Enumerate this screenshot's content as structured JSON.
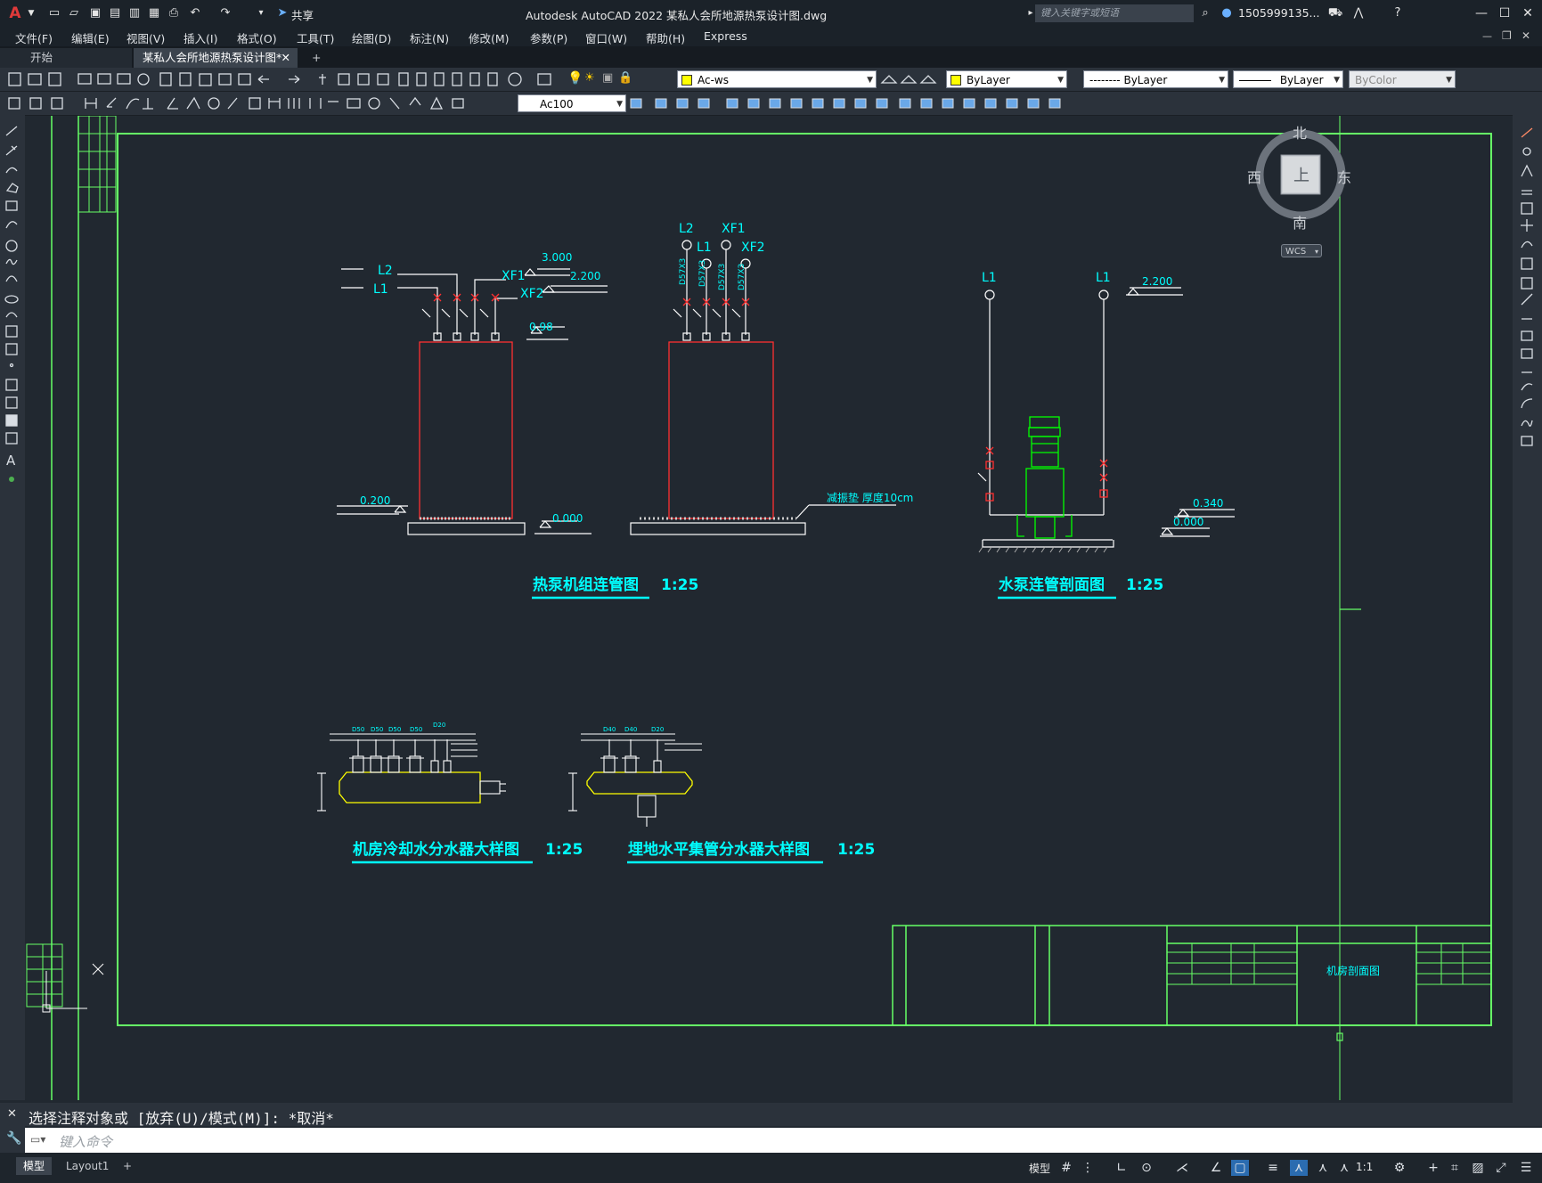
{
  "titlebar": {
    "app_icon": "autocad-a-icon",
    "app_title": "Autodesk AutoCAD 2022    某私人会所地源热泵设计图.dwg",
    "share_label": "共享",
    "search_placeholder": "键入关键字或短语",
    "user_name": "1505999135...",
    "help_icon": "help-icon"
  },
  "menubar": {
    "items": [
      "文件(F)",
      "编辑(E)",
      "视图(V)",
      "插入(I)",
      "格式(O)",
      "工具(T)",
      "绘图(D)",
      "标注(N)",
      "修改(M)",
      "参数(P)",
      "窗口(W)",
      "帮助(H)",
      "Express"
    ]
  },
  "tabs": {
    "start": "开始",
    "active_doc": "某私人会所地源热泵设计图*",
    "add": "+"
  },
  "toolbar": {
    "layer_name": "Ac-ws",
    "color": "ByLayer",
    "linetype": "-------- ByLayer",
    "lineweight": "ByLayer",
    "plotstyle": "ByColor",
    "dimstyle": "Ac100"
  },
  "viewcube": {
    "north": "北",
    "south": "南",
    "east": "东",
    "west": "西",
    "top": "上",
    "wcs": "WCS"
  },
  "drawing": {
    "views": [
      {
        "title": "热泵机组连管图",
        "scale": "1:25"
      },
      {
        "title": "水泵连管剖面图",
        "scale": "1:25"
      },
      {
        "title": "机房冷却水分水器大样图",
        "scale": "1:25"
      },
      {
        "title": "埋地水平集管分水器大样图",
        "scale": "1:25"
      }
    ],
    "pipe_labels": {
      "L1": "L1",
      "L2": "L2",
      "XF1": "XF1",
      "XF2": "XF2"
    },
    "pipe_size": "D57X3",
    "elevations": {
      "e3000": "3.000",
      "e2200": "2.200",
      "e098": "0.98",
      "e0200": "0.200",
      "e0000": "0.000",
      "e0340": "0.340"
    },
    "foundation_note": "减振垫 厚度10cm",
    "manifold_dims_a": [
      "D50",
      "D50",
      "D50",
      "D50",
      "D20"
    ],
    "manifold_dims_b": [
      "D40",
      "D40",
      "D20"
    ],
    "title_block_name": "机房剖面图"
  },
  "command": {
    "history": "选择注释对象或 [放弃(U)/模式(M)]: *取消*",
    "placeholder": "键入命令"
  },
  "status": {
    "model_tab": "模型",
    "layout_tab": "Layout1",
    "add_tab": "+",
    "model_label": "模型",
    "scale": "1:1"
  },
  "colors": {
    "border": "#66ff66",
    "cyan": "#00ffff",
    "red": "#ff3030",
    "yellow": "#ffff00",
    "green": "#00ff00",
    "white": "#ffffff"
  }
}
